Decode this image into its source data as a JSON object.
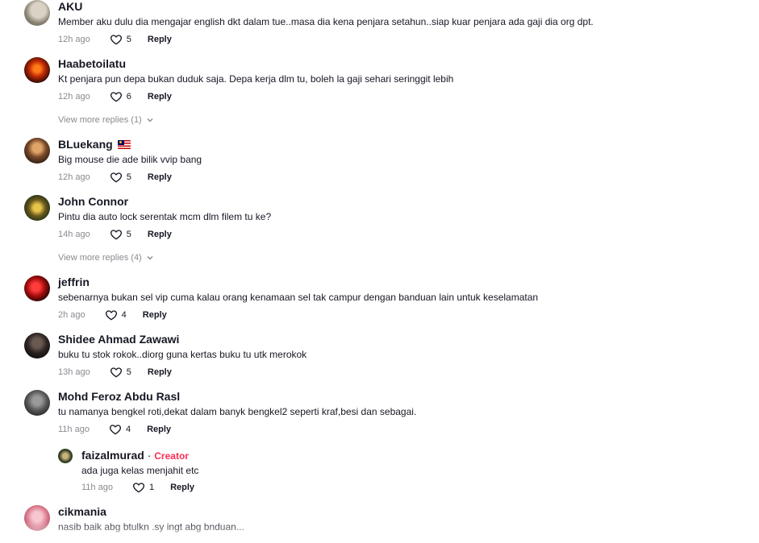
{
  "comments": [
    {
      "name": "AKU",
      "text": "Member aku dulu dia mengajar english dkt dalam tue..masa dia kena penjara setahun..siap kuar penjara ada gaji dia org dpt.",
      "time": "12h ago",
      "likes": "5",
      "reply": "Reply"
    },
    {
      "name": "Haabetoilatu",
      "text": "Kt penjara pun depa bukan duduk saja. Depa kerja dlm tu, boleh la gaji sehari seringgit lebih",
      "time": "12h ago",
      "likes": "6",
      "reply": "Reply",
      "more_replies": "View more replies (1)"
    },
    {
      "name": "BLuekang",
      "flag": "malaysia-flag-icon",
      "text": "Big mouse die ade bilik vvip bang",
      "time": "12h ago",
      "likes": "5",
      "reply": "Reply"
    },
    {
      "name": "John Connor",
      "text": "Pintu dia auto lock serentak mcm dlm filem tu ke?",
      "time": "14h ago",
      "likes": "5",
      "reply": "Reply",
      "more_replies": "View more replies (4)"
    },
    {
      "name": "jeffrin",
      "text": "sebenarnya bukan sel vip cuma kalau orang kenamaan sel tak campur dengan banduan lain untuk keselamatan",
      "time": "2h ago",
      "likes": "4",
      "reply": "Reply"
    },
    {
      "name": "Shidee Ahmad Zawawi",
      "text": "buku tu stok rokok..diorg guna kertas buku tu utk merokok",
      "time": "13h ago",
      "likes": "5",
      "reply": "Reply"
    },
    {
      "name": "Mohd Feroz Abdu Rasl",
      "text": "tu namanya bengkel roti,dekat dalam banyk bengkel2 seperti kraf,besi dan sebagai.",
      "time": "11h ago",
      "likes": "4",
      "reply": "Reply",
      "replies": [
        {
          "name": "faizalmurad",
          "separator": " · ",
          "badge": "Creator",
          "text": "ada juga kelas menjahit etc",
          "time": "11h ago",
          "likes": "1",
          "reply": "Reply"
        }
      ]
    },
    {
      "name": "cikmania",
      "text": "nasib baik abg btulkn .sy ingt abg bnduan...",
      "time": "",
      "likes": "",
      "reply": ""
    }
  ],
  "colors": {
    "accent": "#fe2c55",
    "muted": "#8a8b91",
    "text": "#161823"
  }
}
